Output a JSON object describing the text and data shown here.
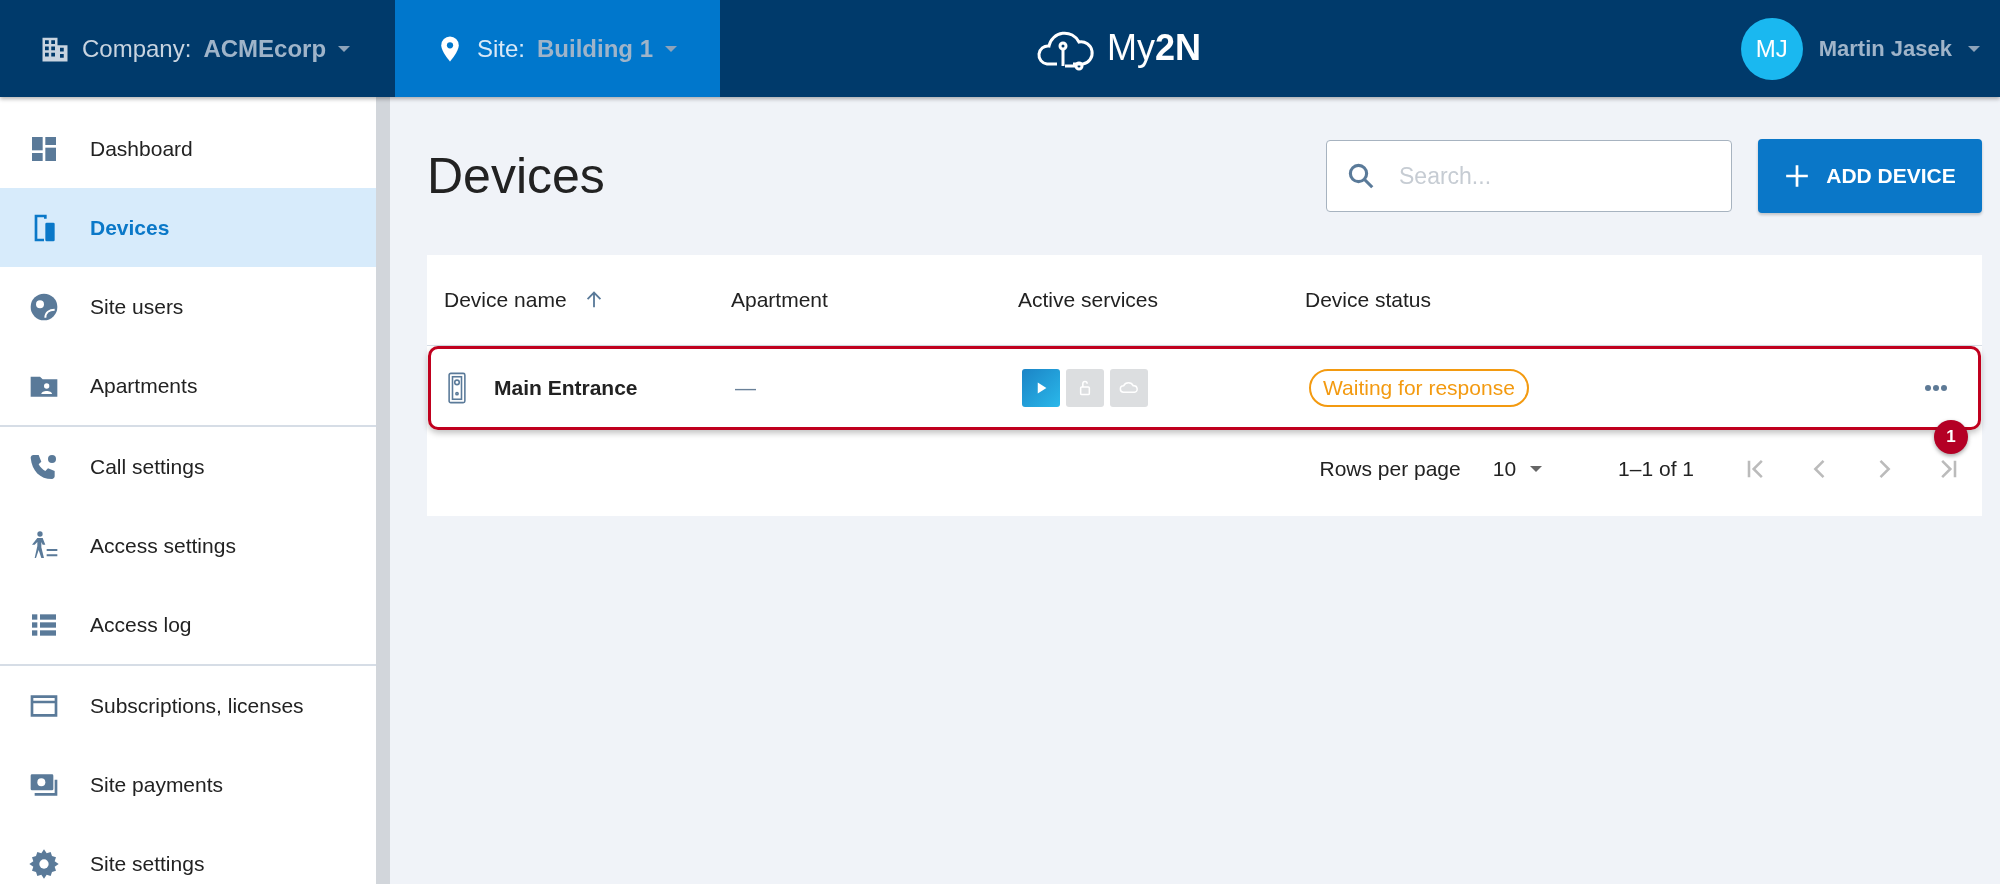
{
  "header": {
    "company_label": "Company:",
    "company": "ACMEcorp",
    "site_label": "Site:",
    "site": "Building 1",
    "logo_light": "My",
    "logo_bold": "2N",
    "user_initials": "MJ",
    "user_name": "Martin Jasek"
  },
  "sidebar": {
    "groups": [
      [
        {
          "label": "Dashboard",
          "selected": false
        },
        {
          "label": "Devices",
          "selected": true
        },
        {
          "label": "Site users",
          "selected": false
        },
        {
          "label": "Apartments",
          "selected": false
        }
      ],
      [
        {
          "label": "Call settings",
          "selected": false
        },
        {
          "label": "Access settings",
          "selected": false
        },
        {
          "label": "Access log",
          "selected": false
        }
      ],
      [
        {
          "label": "Subscriptions, licenses",
          "selected": false
        },
        {
          "label": "Site payments",
          "selected": false
        },
        {
          "label": "Site settings",
          "selected": false
        }
      ]
    ]
  },
  "page": {
    "title": "Devices",
    "search": {
      "placeholder": "Search..."
    },
    "add_button": "ADD DEVICE"
  },
  "table": {
    "columns": [
      {
        "label": "Device name",
        "sorted": true
      },
      {
        "label": "Apartment",
        "sorted": false
      },
      {
        "label": "Active services",
        "sorted": false
      },
      {
        "label": "Device status",
        "sorted": false
      }
    ],
    "rows": [
      {
        "name": "Main Entrance",
        "apartment": "—",
        "services": [
          {
            "kind": "video",
            "active": true
          },
          {
            "kind": "lock",
            "active": false
          },
          {
            "kind": "cloud",
            "active": false
          }
        ],
        "status": "Waiting for response",
        "highlighted": true,
        "callout": "1"
      }
    ],
    "pagination": {
      "rows_label": "Rows per page",
      "rows_value": "10",
      "range": "1–1 of 1"
    }
  }
}
